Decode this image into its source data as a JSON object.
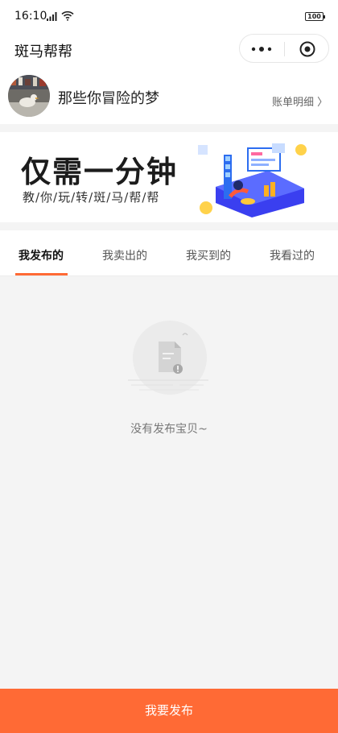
{
  "status_bar": {
    "time": "16:10",
    "battery": "100"
  },
  "nav": {
    "title": "斑马帮帮"
  },
  "profile": {
    "name": "那些你冒险的梦",
    "account_link": "账单明细 〉"
  },
  "banner": {
    "headline": "仅需一分钟",
    "subtitle": "教/你/玩/转/斑/马/帮/帮"
  },
  "tabs": [
    {
      "label": "我发布的",
      "active": true
    },
    {
      "label": "我卖出的",
      "active": false
    },
    {
      "label": "我买到的",
      "active": false
    },
    {
      "label": "我看过的",
      "active": false
    }
  ],
  "empty_state": {
    "message": "没有发布宝贝~"
  },
  "footer": {
    "publish_label": "我要发布"
  },
  "colors": {
    "accent": "#ff6a35",
    "background": "#f4f4f4"
  }
}
